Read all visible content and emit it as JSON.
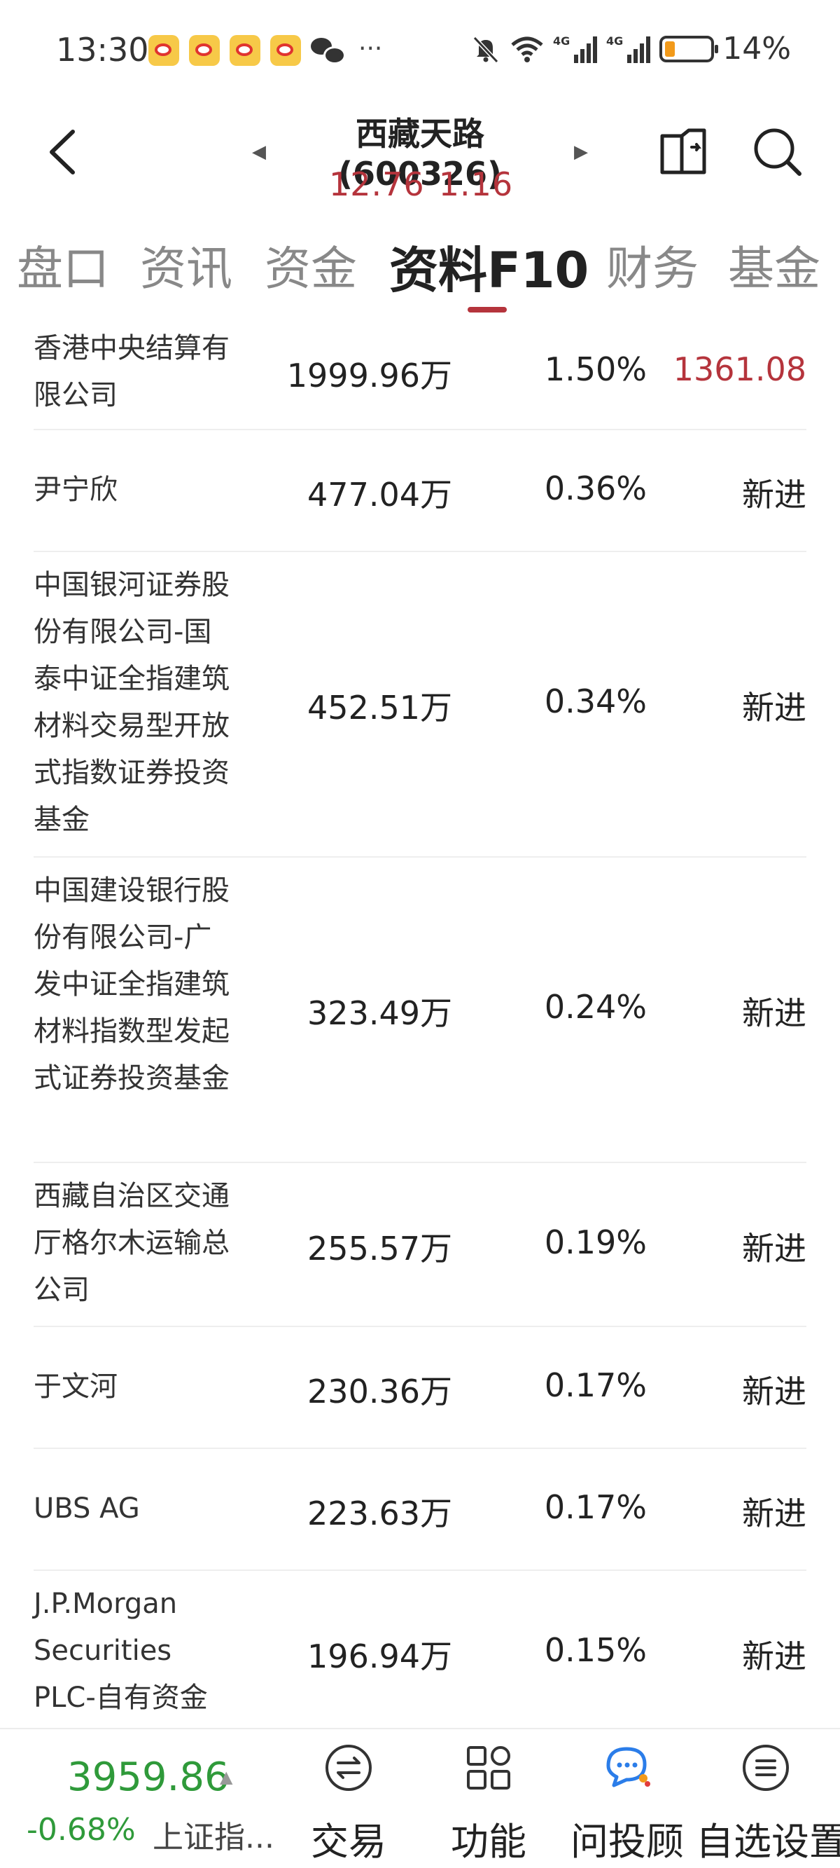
{
  "status_bar": {
    "time": "13:30",
    "overflow": "···",
    "network_1": "4G",
    "network_2": "4G",
    "battery": "14%",
    "colors": {
      "battery_fill": "#f29a1a"
    }
  },
  "header": {
    "title": "西藏天路(600326)",
    "price": "12.76",
    "change": "1.16",
    "colors": {
      "price": "#b5343c"
    }
  },
  "tabs": [
    {
      "label": "盘口"
    },
    {
      "label": "资讯"
    },
    {
      "label": "资金"
    },
    {
      "label": "资料F10",
      "active": true
    },
    {
      "label": "财务"
    },
    {
      "label": "基金"
    }
  ],
  "holders": [
    {
      "name": "香港中央结算有限公司",
      "volume": "1999.96万",
      "percent": "1.50%",
      "change": "1361.08"
    },
    {
      "name": "尹宁欣",
      "volume": "477.04万",
      "percent": "0.36%",
      "change": "新进"
    },
    {
      "name": "中国银河证券股份有限公司-国泰中证全指建筑材料交易型开放式指数证券投资基金",
      "volume": "452.51万",
      "percent": "0.34%",
      "change": "新进"
    },
    {
      "name": "中国建设银行股份有限公司-广发中证全指建筑材料指数型发起式证券投资基金",
      "volume": "323.49万",
      "percent": "0.24%",
      "change": "新进"
    },
    {
      "name": "西藏自治区交通厅格尔木运输总公司",
      "volume": "255.57万",
      "percent": "0.19%",
      "change": "新进"
    },
    {
      "name": "于文河",
      "volume": "230.36万",
      "percent": "0.17%",
      "change": "新进"
    },
    {
      "name": "UBS  AG",
      "volume": "223.63万",
      "percent": "0.17%",
      "change": "新进"
    },
    {
      "name": "J.P.Morgan Securities PLC-自有资金",
      "volume": "196.94万",
      "percent": "0.15%",
      "change": "新进"
    }
  ],
  "bottom_bar": {
    "index_value": "3959.86",
    "index_change": "-0.68%",
    "index_name": "上证指...",
    "nav": [
      {
        "label": "交易",
        "icon": "exchange-icon"
      },
      {
        "label": "功能",
        "icon": "grid-icon"
      },
      {
        "label": "问投顾",
        "icon": "chat-icon"
      },
      {
        "label": "自选设置",
        "icon": "menu-list-icon"
      }
    ],
    "colors": {
      "index": "#2f9a3a"
    }
  }
}
